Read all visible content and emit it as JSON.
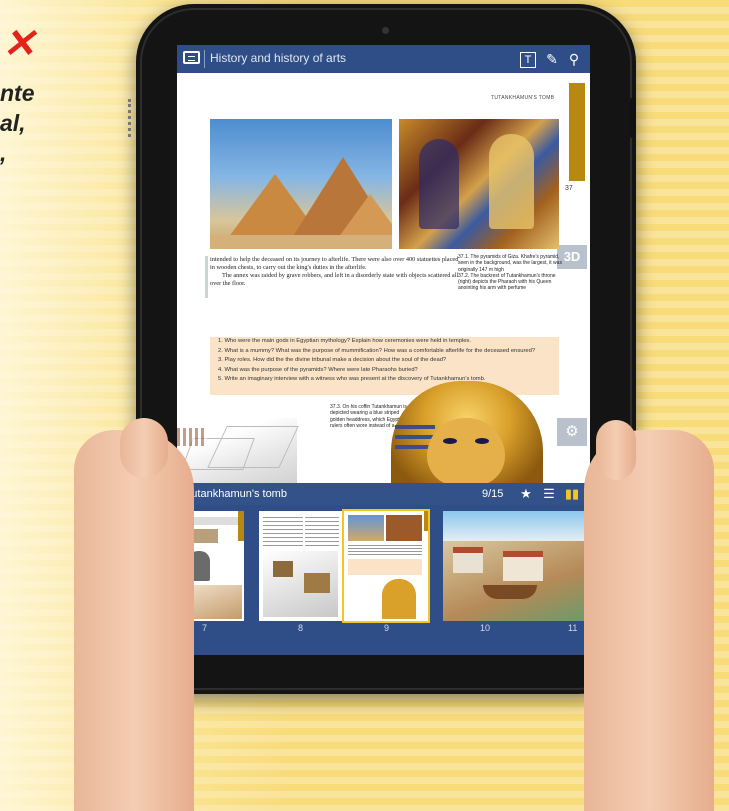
{
  "background": {
    "text_lines": [
      "nte",
      "al,",
      ","
    ]
  },
  "app": {
    "title": "History and history of arts",
    "toolbar_icons": [
      "text-size-icon",
      "pencil-icon",
      "search-icon"
    ]
  },
  "page": {
    "running_head": "TUTANKHAMUN'S TOMB",
    "page_number": "37",
    "button_3d": "3D",
    "body_text": [
      "intended to help the deceased on its journey to afterlife. There were also over 400 statuettes placed in wooden chests, to carry out the king's duties in the afterlife.",
      "The annex was raided by grave robbers, and left in a disorderly state with objects scattered all over the floor."
    ],
    "caption_1": "37.1. The pyramids of Giza. Khafre's pyramid, seen in the background, was the largest, it was originally 147 m high",
    "caption_2": "37.2. The backrest of Tutankhamun's throne (right) depicts the Pharaoh with his Queen anointing his arm with perfume",
    "caption_3": "37.3. On his coffin Tutankhamun is depicted wearing a blue striped golden headdress, which Egyptian rulers often wore instead of a crown",
    "questions": [
      "1. Who were the main gods in Egyptian mythology? Explain how ceremonies were held in temples.",
      "2. What is a mummy? What was the purpose of mummification? How was a comfortable afterlife for the deceased ensured?",
      "3. Play roles. How did the the divine tribunal make a decision about the soul of the dead?",
      "4. What was the purpose of the pyramids? Where were late Pharaohs buried?",
      "5. Write an imaginary interview with a witness who was present at the discovery of Tutankhamun's tomb."
    ]
  },
  "thumbnail_bar": {
    "title": "Tutankhamun's tomb",
    "page_count": "9/15",
    "thumbnails": [
      {
        "label": "7"
      },
      {
        "label": "8"
      },
      {
        "label": "9"
      },
      {
        "label": "10"
      },
      {
        "label": "11"
      }
    ]
  },
  "colors": {
    "toolbar_blue": "#2f4d86",
    "accent_gold": "#b88810",
    "selected_outline": "#f3c623"
  }
}
